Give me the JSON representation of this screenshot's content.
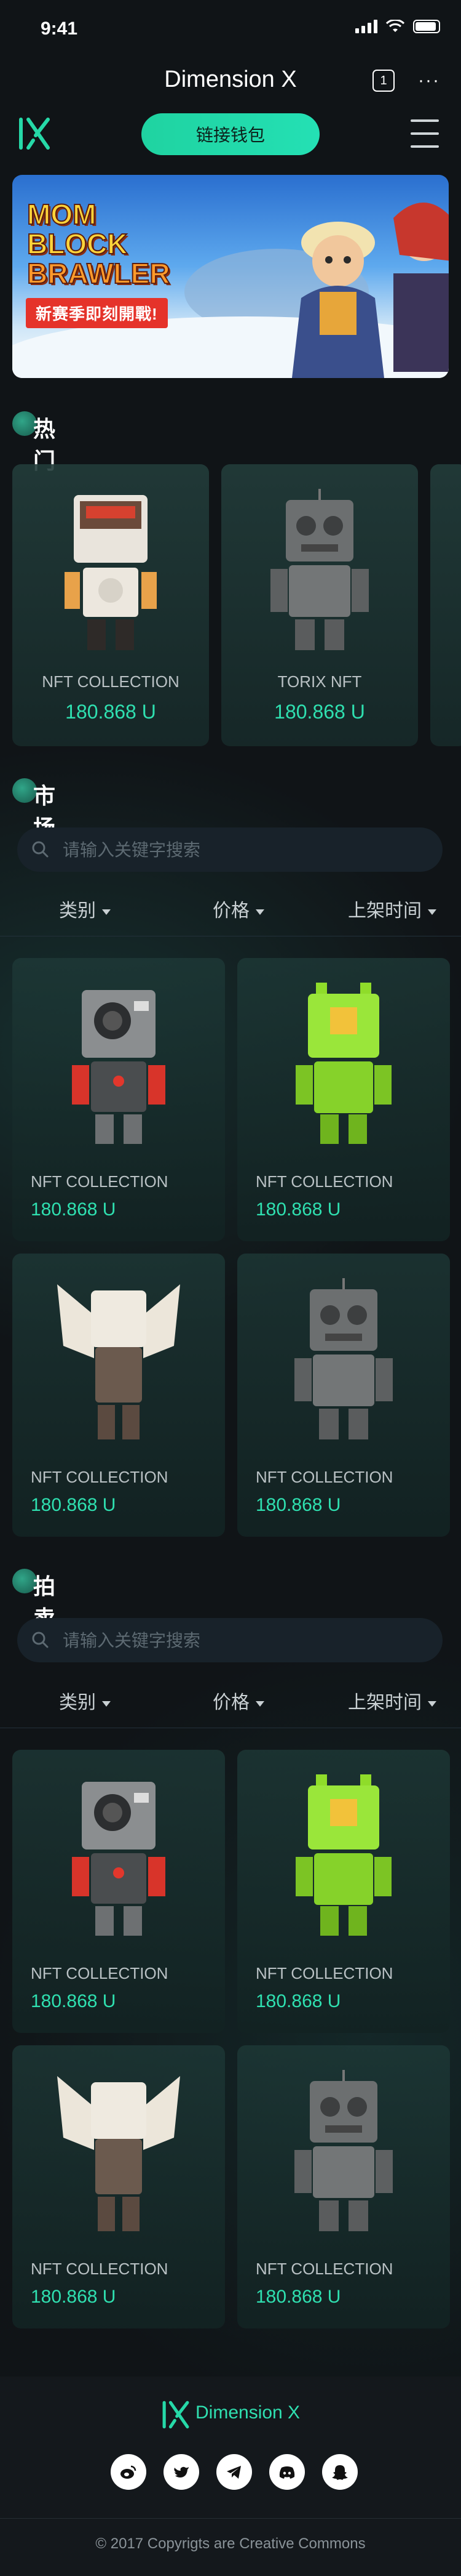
{
  "status_bar": {
    "time": "9:41"
  },
  "app_bar": {
    "title": "Dimension X",
    "tab_count": "1",
    "more": "···"
  },
  "header": {
    "connect_wallet": "链接钱包"
  },
  "banner": {
    "title_line1": "MOM",
    "title_line2": "BLOCK",
    "title_line3": "BRAWLER",
    "tagline": "新赛季即刻開戰!"
  },
  "hot": {
    "title": "热门",
    "items": [
      {
        "name": "NFT COLLECTION",
        "price": "180.868 U"
      },
      {
        "name": "TORIX NFT",
        "price": "180.868 U"
      }
    ]
  },
  "market": {
    "title": "市场",
    "search_placeholder": "请输入关键字搜索",
    "filters": {
      "category": "类别",
      "price": "价格",
      "listing_time": "上架时间"
    },
    "items": [
      {
        "name": "NFT COLLECTION",
        "price": "180.868 U"
      },
      {
        "name": "NFT COLLECTION",
        "price": "180.868 U"
      },
      {
        "name": "NFT COLLECTION",
        "price": "180.868 U"
      },
      {
        "name": "NFT COLLECTION",
        "price": "180.868 U"
      }
    ]
  },
  "auction": {
    "title": "拍卖",
    "search_placeholder": "请输入关键字搜索",
    "filters": {
      "category": "类别",
      "price": "价格",
      "listing_time": "上架时间"
    },
    "items": [
      {
        "name": "NFT COLLECTION",
        "price": "180.868 U"
      },
      {
        "name": "NFT COLLECTION",
        "price": "180.868 U"
      },
      {
        "name": "NFT COLLECTION",
        "price": "180.868 U"
      },
      {
        "name": "NFT COLLECTION",
        "price": "180.868 U"
      }
    ]
  },
  "footer": {
    "brand": "Dimension X",
    "socials": [
      "weibo-icon",
      "twitter-icon",
      "telegram-icon",
      "discord-icon",
      "snapchat-icon"
    ],
    "copyright": "© 2017  Copyrigts are Creative Commons"
  },
  "colors": {
    "accent": "#2fe0b0",
    "background": "#101417",
    "button": "#1fd3a1"
  }
}
